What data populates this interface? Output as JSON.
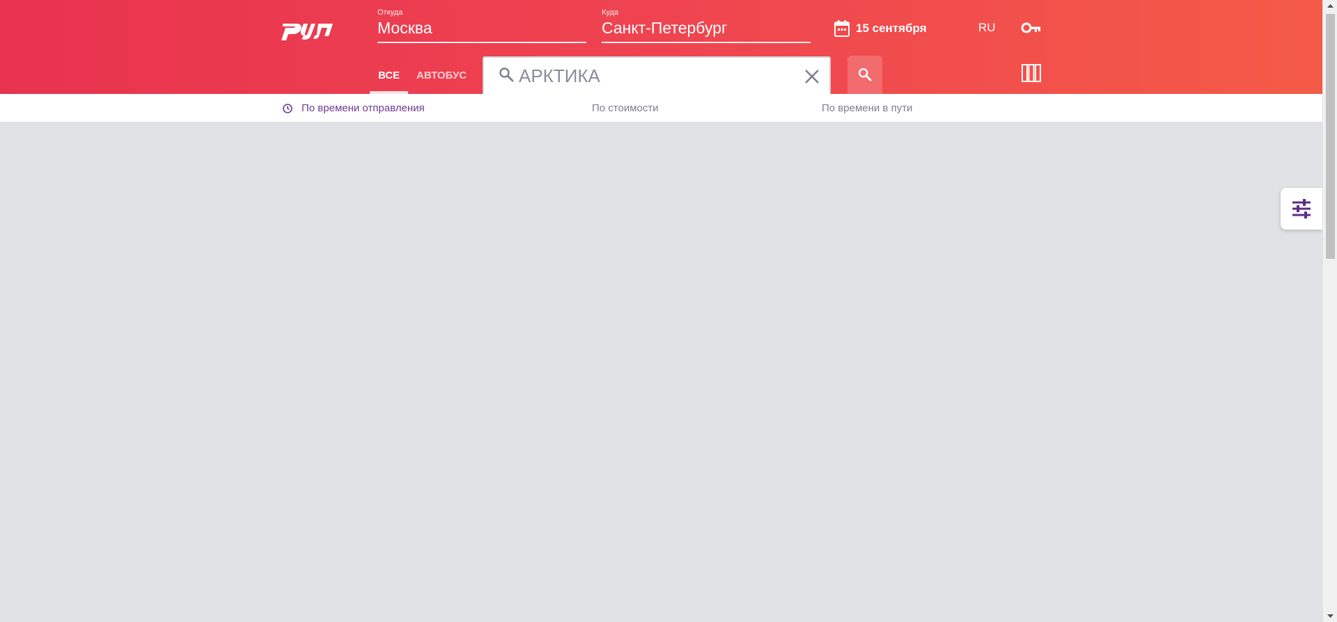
{
  "header": {
    "from": {
      "label": "Откуда",
      "value": "Москва"
    },
    "to": {
      "label": "Куда",
      "value": "Санкт-Петербург"
    },
    "date": "15 сентября",
    "language": "RU"
  },
  "tabs": [
    {
      "label": "ВСЕ",
      "active": true
    },
    {
      "label": "АВТОБУС",
      "active": false
    }
  ],
  "search": {
    "value": "АРКТИКА",
    "placeholder": ""
  },
  "sort": {
    "by_departure": "По времени отправления",
    "by_price": "По стоимости",
    "by_duration": "По времени в пути",
    "active": "by_departure"
  },
  "icons": {
    "logo": "rzd-logo",
    "calendar": "calendar-icon",
    "key": "key-icon",
    "search": "search-icon",
    "clear": "close-icon",
    "stations": "stations-icon",
    "clock": "clock-icon",
    "filter": "filter-sliders-icon"
  },
  "colors": {
    "header_gradient_start": "#e8334f",
    "header_gradient_end": "#f45b47",
    "accent_purple": "#6e3b8f",
    "background": "#e1e2e6"
  }
}
